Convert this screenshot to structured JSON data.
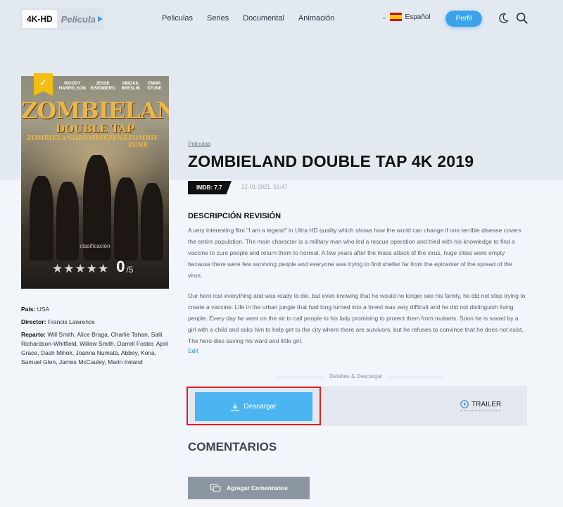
{
  "header": {
    "logo_badge": "4K-HD",
    "logo_text": "Pelicula",
    "nav": [
      "Peliculas",
      "Series",
      "Documental",
      "Animación"
    ],
    "language": "Español",
    "profile_label": "Perfil"
  },
  "poster": {
    "cast_names": [
      "WOODY HARRELSON",
      "JESSE EISENBERG",
      "ABIGAIL BRESLIN",
      "EMMA STONE"
    ],
    "title": "ZOMBIELAND",
    "subtitle": "DOUBLE TAP",
    "intl_titles": [
      "ZOMBIELAND",
      "ZOMBIEZENE",
      "ZOMBIE ZENE"
    ],
    "rating_label": "clasificación",
    "stars": "★★★★★",
    "score": "0",
    "score_max": "/5",
    "rating_value": 0
  },
  "details": {
    "country_label": "País:",
    "country": "USA",
    "director_label": "Director:",
    "director": "Francis Lawrence",
    "cast_label": "Reparto:",
    "cast": "Will Smith, Alice Braga, Charlie Tahan, Salli Richardson-Whitfield, Willow Smith, Darrell Foster, April Grace, Dash Mihok, Joanna Numata, Abbey, Kona, Samuel Glen, James McCauley, Marin Ireland"
  },
  "main": {
    "breadcrumb": "Peliculas",
    "title": "ZOMBIELAND DOUBLE TAP 4K 2019",
    "imdb": "IMDB: 7.7",
    "date": "22-01-2021, 01:47",
    "desc_heading": "DESCRIPCIÓN REVISIÓN",
    "desc_p1": "A very interesting film \"I am a legend\" in Ultra HD quality which shows how the world can change if one terrible disease covers the entire population.  The main character is a military man who led a rescue operation and tried with his knowledge to find a vaccine to cure people and return them to normal.  A few years after the mass attack of the virus, huge cities were empty because there were few surviving people and everyone was trying to find shelter far from the epicenter of the spread of the virus.",
    "desc_p2": "Our hero lost everything and was ready to die, but even knowing that he would no longer see his family, he did not stop trying to create a vaccine.  Life in the urban jungle that had long turned into a forest was very difficult and he did not distinguish living people.  Every day he went on the air to call people to his lady promising to protect them from mutants.  Soon he is saved by a girl with a child and asks him to help get to the city where there are survivors, but he refuses to convince that he does not exist.  The hero dies saving his ward and little girl.",
    "edit": "Edit",
    "separator": "Detalles & Descargar",
    "download": "Descargar",
    "trailer": "TRAILER",
    "comments_heading": "COMENTARIOS",
    "add_comment": "Agregar Comentarios"
  },
  "colors": {
    "accent": "#4ab5f0",
    "highlight": "#e02020",
    "badge": "#f3bd11"
  }
}
